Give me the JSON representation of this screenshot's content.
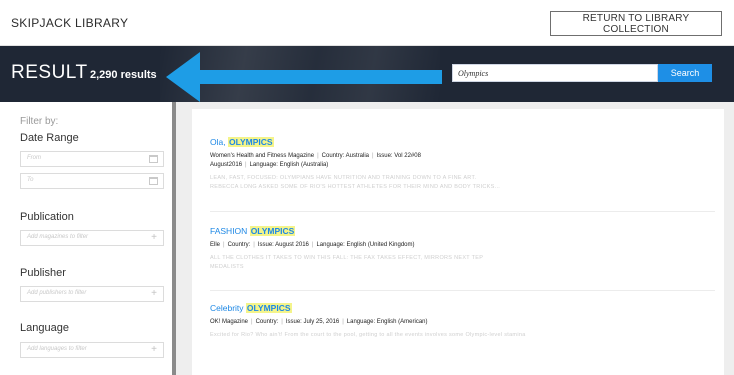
{
  "header": {
    "brand": "SKIPJACK LIBRARY",
    "return_label": "RETURN TO LIBRARY COLLECTION"
  },
  "results_bar": {
    "label": "RESULT",
    "count": "2,290 results",
    "search_value": "Olympics",
    "search_button": "Search",
    "arrow_color": "#1e9de6"
  },
  "sidebar": {
    "filter_by": "Filter by:",
    "date_range": {
      "title": "Date Range",
      "from_placeholder": "From",
      "to_placeholder": "To"
    },
    "publication": {
      "title": "Publication",
      "placeholder": "Add magazines to filter"
    },
    "publisher": {
      "title": "Publisher",
      "placeholder": "Add publishers to filter"
    },
    "language": {
      "title": "Language",
      "placeholder": "Add languages to filter"
    }
  },
  "results": [
    {
      "title_prefix": "Ola, ",
      "title_highlight": "OLYMPICS",
      "meta_line1": [
        "Women's Health and Fitness Magazine",
        "Country: Australia",
        "Issue: Vol 22#08"
      ],
      "meta_line2": [
        "August2016",
        "Language: English (Australia)"
      ],
      "desc_line1": "LEAN, FAST, FOCUSED: OLYMPIANS HAVE NUTRITION AND TRAINING DOWN TO A FINE ART.",
      "desc_line2": "REBECCA LONG ASKED SOME OF RIO'S HOTTEST ATHLETES FOR THEIR MIND AND BODY TRICKS..."
    },
    {
      "title_prefix": "FASHION ",
      "title_highlight": "OLYMPICS",
      "meta_line1": [
        "Elle",
        "Country:",
        "Issue: August 2016",
        "Language: English (United Kingdom)"
      ],
      "desc_line1": "ALL THE CLOTHES IT TAKES TO WIN THIS FALL: THE FAX TAKES EFFECT, MIRRORS NEXT TEP",
      "desc_line2": "MEDALISTS"
    },
    {
      "title_prefix": "Celebrity ",
      "title_highlight": "OLYMPICS",
      "meta_line1": [
        "OK! Magazine",
        "Country:",
        "Issue: July 25, 2016",
        "Language: English (American)"
      ],
      "desc_line1": "Excited for Rio? Who ain't! From the court to the pool, getting to all the events involves some Olympic-level stamina"
    }
  ]
}
